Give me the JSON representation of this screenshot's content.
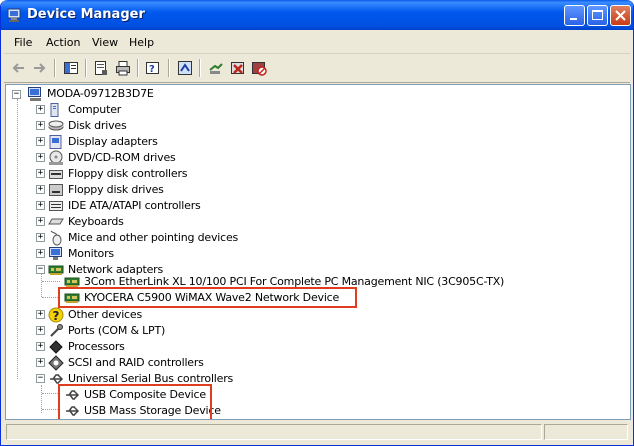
{
  "window": {
    "title": "Device Manager"
  },
  "menu": [
    "File",
    "Action",
    "View",
    "Help"
  ],
  "toolbar": {
    "icons": [
      "back-arrow-icon",
      "forward-arrow-icon",
      "show-hide-tree-icon",
      "properties-icon",
      "print-icon",
      "help-icon",
      "scan-hardware-icon",
      "update-driver-icon",
      "uninstall-icon",
      "disable-icon"
    ]
  },
  "tree": {
    "root": "MODA-09712B3D7E",
    "categories": [
      "Computer",
      "Disk drives",
      "Display adapters",
      "DVD/CD-ROM drives",
      "Floppy disk controllers",
      "Floppy disk drives",
      "IDE ATA/ATAPI controllers",
      "Keyboards",
      "Mice and other pointing devices",
      "Monitors",
      "Network adapters",
      "Other devices",
      "Ports (COM & LPT)",
      "Processors",
      "SCSI and RAID controllers",
      "Universal Serial Bus controllers"
    ],
    "network_devices": [
      "3Com EtherLink XL 10/100 PCI For Complete PC Management NIC (3C905C-TX)",
      "KYOCERA C5900 WiMAX Wave2 Network Device"
    ],
    "usb_devices": [
      "USB Composite Device",
      "USB Mass Storage Device"
    ]
  },
  "colors": {
    "highlight": "#e03c1f",
    "titlebar": "#0058ee"
  }
}
